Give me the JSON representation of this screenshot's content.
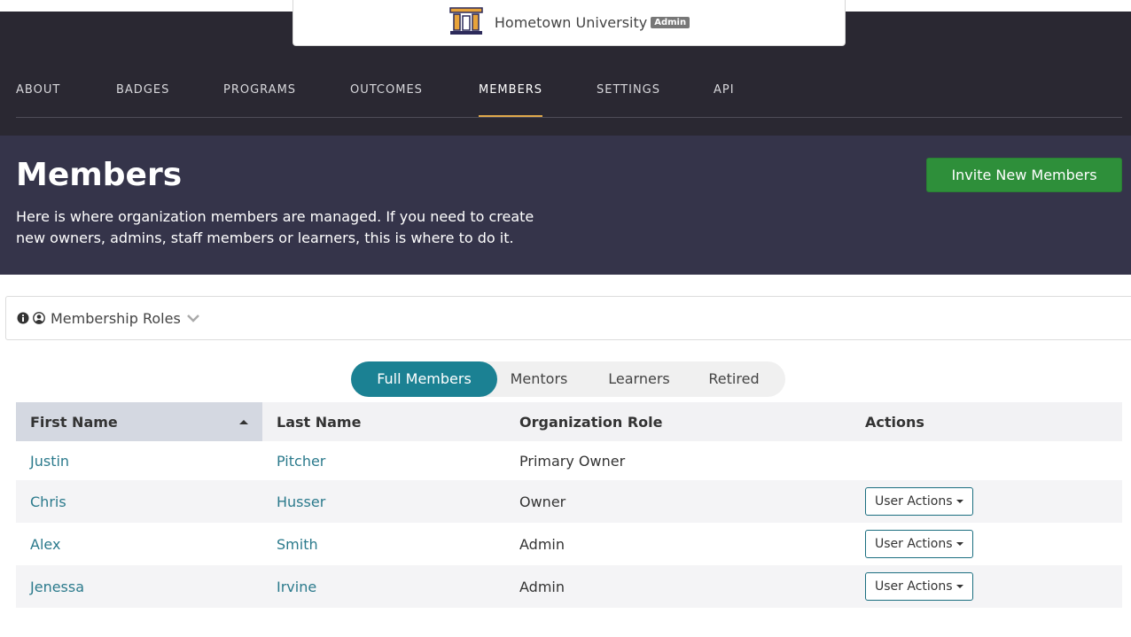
{
  "org": {
    "name": "Hometown University",
    "badge": "Admin",
    "logo_icon": "university-columns-icon"
  },
  "nav": {
    "tabs": [
      {
        "label": "ABOUT",
        "active": false
      },
      {
        "label": "BADGES",
        "active": false
      },
      {
        "label": "PROGRAMS",
        "active": false
      },
      {
        "label": "OUTCOMES",
        "active": false
      },
      {
        "label": "MEMBERS",
        "active": true
      },
      {
        "label": "SETTINGS",
        "active": false
      },
      {
        "label": "API",
        "active": false
      }
    ],
    "active_indicator_color": "#e0a94b"
  },
  "hero": {
    "title": "Members",
    "description": "Here is where organization members are managed. If you need to create new owners, admins, staff members or learners, this is where to do it.",
    "invite_label": "Invite New Members"
  },
  "roles_panel": {
    "label": "Membership Roles",
    "icons": [
      "info-icon",
      "user-circle-icon",
      "chevron-down-icon"
    ]
  },
  "subtabs": [
    {
      "label": "Full Members",
      "active": true
    },
    {
      "label": "Mentors",
      "active": false
    },
    {
      "label": "Learners",
      "active": false
    },
    {
      "label": "Retired",
      "active": false
    }
  ],
  "table": {
    "headers": [
      "First Name",
      "Last Name",
      "Organization Role",
      "Actions"
    ],
    "sorted_column": "First Name",
    "sort_direction": "ascending",
    "action_label": "User Actions",
    "rows": [
      {
        "first": "Justin",
        "last": "Pitcher",
        "role": "Primary Owner",
        "has_actions": false
      },
      {
        "first": "Chris",
        "last": "Husser",
        "role": "Owner",
        "has_actions": true
      },
      {
        "first": "Alex",
        "last": "Smith",
        "role": "Admin",
        "has_actions": true
      },
      {
        "first": "Jenessa",
        "last": "Irvine",
        "role": "Admin",
        "has_actions": true
      }
    ]
  },
  "colors": {
    "nav_bg": "#2a2832",
    "hero_bg": "#35344a",
    "invite_bg": "#2e8f3a",
    "subtab_active": "#1b8193",
    "link": "#2b7a8c"
  }
}
